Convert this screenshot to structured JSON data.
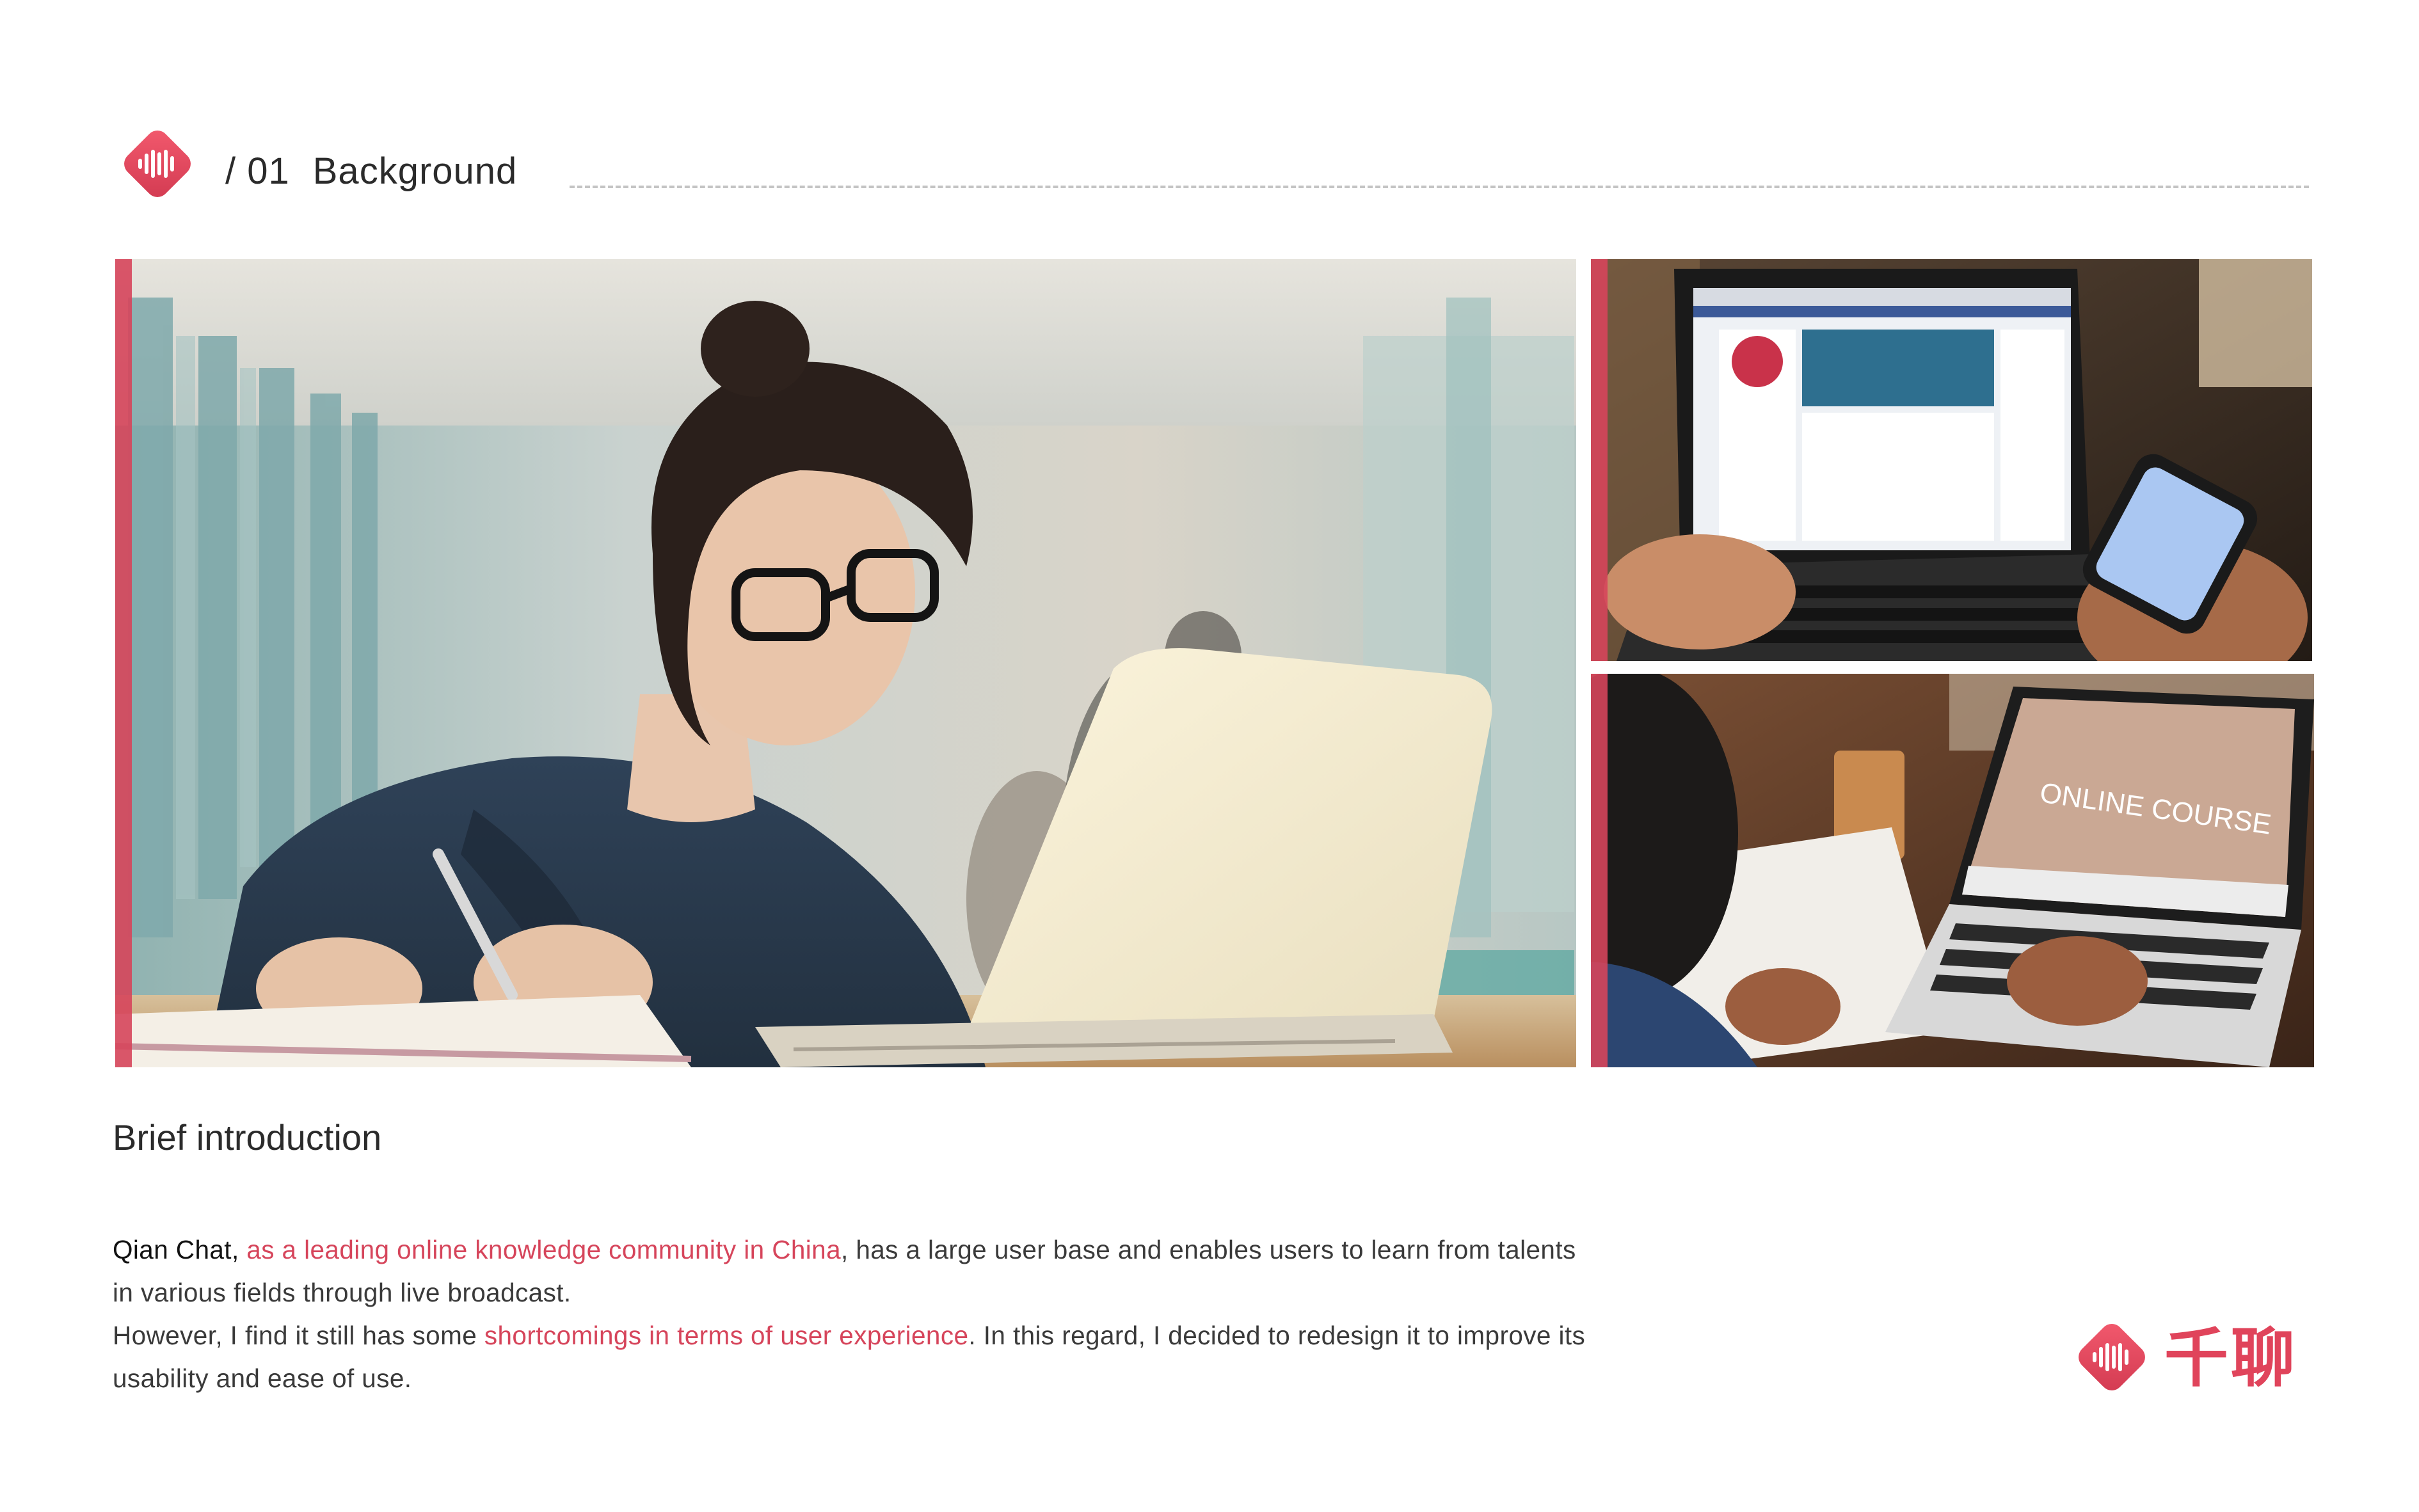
{
  "header": {
    "section_number": "/ 01",
    "section_title": "Background"
  },
  "images": {
    "main": "student-with-laptop-photo",
    "top_right": "laptop-and-phone-photo",
    "bottom_right": "online-course-photo",
    "bottom_right_screen_text": "ONLINE COURSE"
  },
  "intro": {
    "heading": "Brief introduction",
    "p1_a": "Qian Chat, ",
    "p1_b": "as a leading online knowledge community in China",
    "p1_c": ", has a large user base and enables users to learn from talents in various fields through live broadcast.",
    "p2_a": "However, I find it still has some ",
    "p2_b": "shortcomings in terms of user experience",
    "p2_c": ". In this regard, I decided to redesign it to improve its usability and ease of use."
  },
  "brand": {
    "name": "千聊"
  },
  "colors": {
    "accent": "#d6455b",
    "brand_gradient_start": "#f0566a",
    "brand_gradient_end": "#d83a52",
    "text": "#2b2b2b"
  }
}
